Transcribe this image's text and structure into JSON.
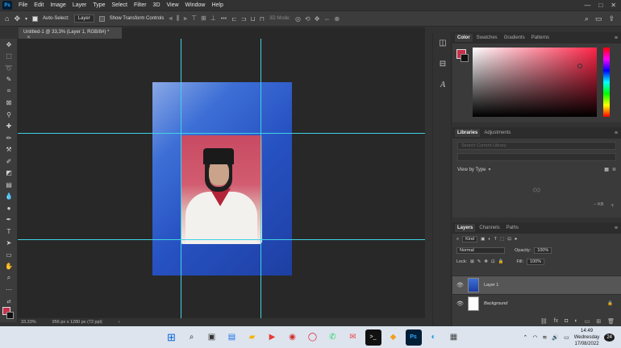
{
  "app": {
    "logo": "Ps",
    "menu": [
      "File",
      "Edit",
      "Image",
      "Layer",
      "Type",
      "Select",
      "Filter",
      "3D",
      "View",
      "Window",
      "Help"
    ],
    "window_controls": [
      "—",
      "□",
      "✕"
    ]
  },
  "options_bar": {
    "auto_select_label": "Auto-Select:",
    "auto_select_checked": true,
    "auto_select_target": "Layer",
    "show_transform_label": "Show Transform Controls",
    "three_d_mode_label": "3D Mode:",
    "more_label": "•••"
  },
  "document": {
    "tab_title": "Untitled-1 @ 33,3% (Layer 1, RGB/8#) *",
    "status_zoom": "33,33%",
    "status_size": "956 px x 1280 px (72 ppi)"
  },
  "panels": {
    "color_tabs": [
      "Color",
      "Swatches",
      "Gradients",
      "Patterns"
    ],
    "library_tabs": [
      "Libraries",
      "Adjustments"
    ],
    "library_search_placeholder": "Search Current Library",
    "library_view": "View by Type",
    "library_size": "-- KB",
    "layers_tabs": [
      "Layers",
      "Channels",
      "Paths"
    ],
    "filter_kind": "Kind",
    "blend_mode": "Normal",
    "opacity_label": "Opacity:",
    "opacity_value": "100%",
    "lock_label": "Lock:",
    "fill_label": "Fill:",
    "fill_value": "100%",
    "layers": [
      {
        "name": "Layer 1",
        "selected": true
      },
      {
        "name": "Background",
        "selected": false,
        "locked": true
      }
    ],
    "colors": {
      "foreground": "#c8314a",
      "background": "#111111",
      "accent": "#31a8ff"
    }
  },
  "taskbar": {
    "time": "14:49",
    "day": "Wednesday",
    "date": "17/08/2022",
    "notification_count": "24"
  }
}
